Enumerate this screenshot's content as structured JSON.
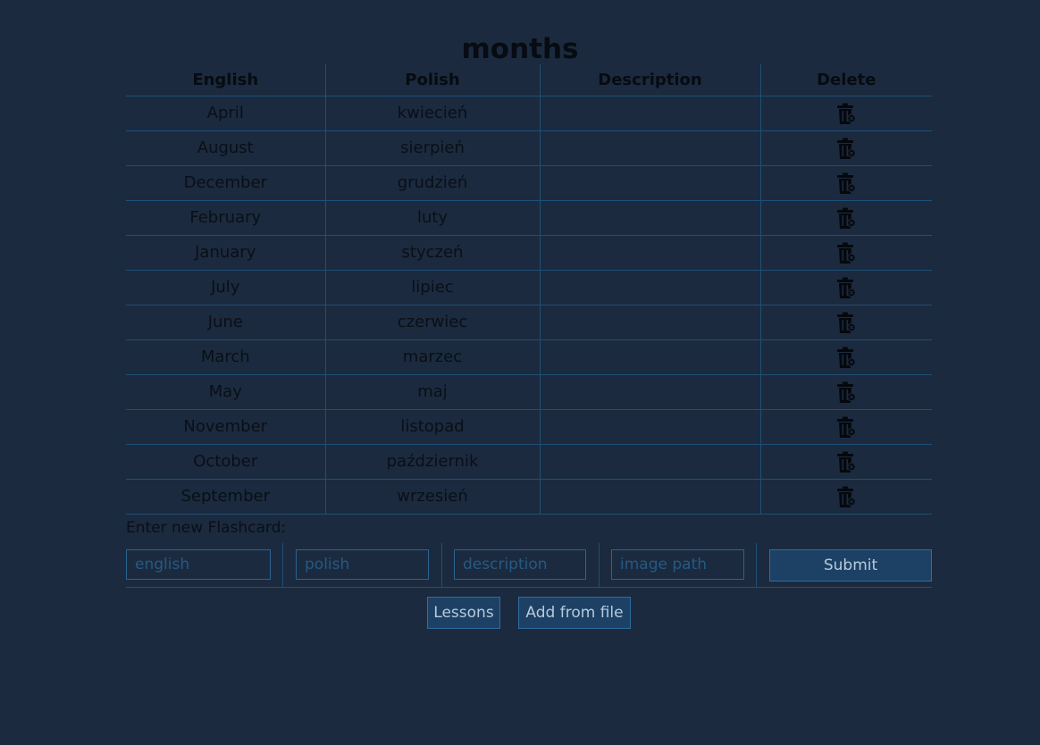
{
  "page": {
    "title": "months"
  },
  "table": {
    "headers": {
      "english": "English",
      "polish": "Polish",
      "description": "Description",
      "delete": "Delete"
    },
    "rows": [
      {
        "english": "April",
        "polish": "kwiecień",
        "description": ""
      },
      {
        "english": "August",
        "polish": "sierpień",
        "description": ""
      },
      {
        "english": "December",
        "polish": "grudzień",
        "description": ""
      },
      {
        "english": "February",
        "polish": "luty",
        "description": ""
      },
      {
        "english": "January",
        "polish": "styczeń",
        "description": ""
      },
      {
        "english": "July",
        "polish": "lipiec",
        "description": ""
      },
      {
        "english": "June",
        "polish": "czerwiec",
        "description": ""
      },
      {
        "english": "March",
        "polish": "marzec",
        "description": ""
      },
      {
        "english": "May",
        "polish": "maj",
        "description": ""
      },
      {
        "english": "November",
        "polish": "listopad",
        "description": ""
      },
      {
        "english": "October",
        "polish": "październik",
        "description": ""
      },
      {
        "english": "September",
        "polish": "wrzesień",
        "description": ""
      }
    ],
    "delete_icon": "trash-icon"
  },
  "form": {
    "label": "Enter new Flashcard:",
    "english": {
      "value": "",
      "placeholder": "english"
    },
    "polish": {
      "value": "",
      "placeholder": "polish"
    },
    "description": {
      "value": "",
      "placeholder": "description"
    },
    "image_path": {
      "value": "",
      "placeholder": "image path"
    },
    "submit_label": "Submit"
  },
  "footer": {
    "lessons_label": "Lessons",
    "add_from_file_label": "Add from file"
  },
  "colors": {
    "background": "#1b2a3e",
    "border": "#1e4f78",
    "button": "#1d4164",
    "text": "#0a0f17"
  }
}
